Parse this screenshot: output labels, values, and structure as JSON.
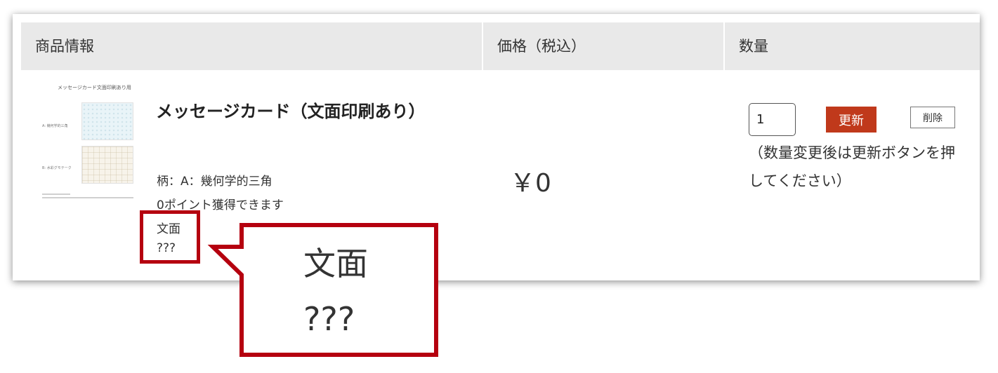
{
  "table": {
    "headers": {
      "product_info": "商品情報",
      "price_tax_incl": "価格（税込）",
      "quantity": "数量"
    }
  },
  "item": {
    "thumbnail": {
      "title": "メッセージカード文面印刷あり用",
      "label_a": "A: 幾何学的三角",
      "label_b": "B: 水彩グモテーク"
    },
    "name": "メッセージカード（文面印刷あり）",
    "pattern": "柄：A：幾何学的三角",
    "points": "0ポイント獲得できます",
    "message_label": "文面",
    "message_value": "???",
    "price": "￥0",
    "quantity_value": "1",
    "update_label": "更新",
    "delete_label": "削除",
    "quantity_note": "（数量変更後は更新ボタンを押してください）"
  },
  "callout": {
    "line1": "文面",
    "line2": "???"
  },
  "colors": {
    "header_bg": "#e9e9e9",
    "update_button": "#c0391b",
    "highlight": "#b5000f"
  }
}
